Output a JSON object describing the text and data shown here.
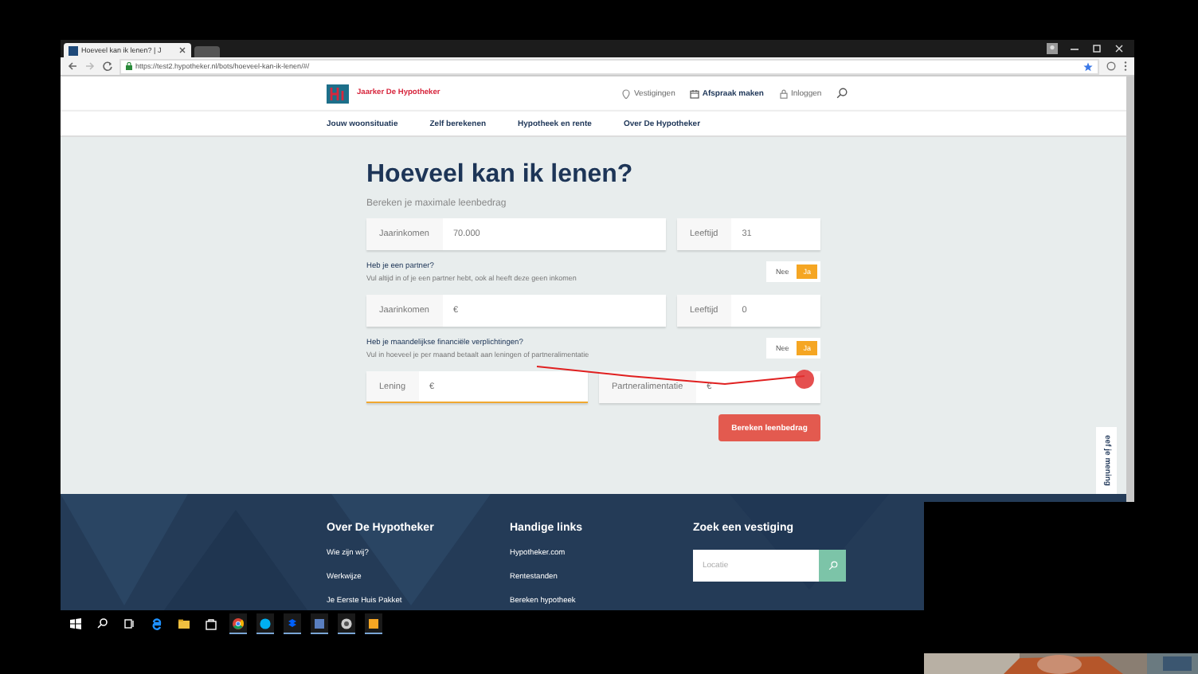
{
  "browser": {
    "tab_title": "Hoeveel kan ik lenen? | J",
    "url": "https://test2.hypotheker.nl/bots/hoeveel-kan-ik-lenen/#/"
  },
  "site_header": {
    "brand": "Jaarker De Hypotheker",
    "links": [
      {
        "label": "Vestigingen",
        "kind": "pin"
      },
      {
        "label": "Afspraak maken",
        "kind": "calendar"
      },
      {
        "label": "Inloggen",
        "kind": "lock"
      }
    ]
  },
  "nav": [
    "Jouw woonsituatie",
    "Zelf berekenen",
    "Hypotheek en rente",
    "Over De Hypotheker"
  ],
  "form": {
    "title": "Hoeveel kan ik lenen?",
    "subtitle": "Bereken je maximale leenbedrag",
    "rows": [
      {
        "kind": "fields",
        "fields": [
          {
            "label": "Jaarinkomen",
            "value": "70.000",
            "focused": false
          },
          {
            "label": "Leeftijd",
            "value": "31",
            "focused": false
          }
        ]
      },
      {
        "kind": "question",
        "question": "Heb je een partner?",
        "hint": "Vul altijd in of je een partner hebt, ook al heeft deze geen inkomen",
        "options": [
          {
            "label": "Nee",
            "selected": false
          },
          {
            "label": "Ja",
            "selected": true
          }
        ]
      },
      {
        "kind": "fields",
        "fields": [
          {
            "label": "Jaarinkomen",
            "value": "€",
            "focused": false
          },
          {
            "label": "Leeftijd",
            "value": "0",
            "focused": false
          }
        ]
      },
      {
        "kind": "question",
        "question": "Heb je maandelijkse financiële verplichtingen?",
        "hint": "Vul in hoeveel je per maand betaalt aan leningen of partneralimentatie",
        "options": [
          {
            "label": "Nee",
            "selected": false
          },
          {
            "label": "Ja",
            "selected": true
          }
        ]
      },
      {
        "kind": "fields",
        "fields": [
          {
            "label": "Lening",
            "value": "€",
            "focused": true
          },
          {
            "label": "Partneralimentatie",
            "value": "€",
            "focused": false
          }
        ]
      }
    ],
    "submit_button": "Bereken leenbedrag"
  },
  "feedback_tab": "eef je mening",
  "footer": {
    "columns": [
      {
        "heading": "Over De Hypotheker",
        "links": [
          "Wie zijn wij?",
          "Werkwijze",
          "Je Eerste Huis Pakket"
        ]
      },
      {
        "heading": "Handige links",
        "links": [
          "Hypotheker.com",
          "Rentestanden",
          "Bereken hypotheek"
        ]
      }
    ],
    "search": {
      "heading": "Zoek een vestiging",
      "placeholder": "Locatie"
    }
  }
}
